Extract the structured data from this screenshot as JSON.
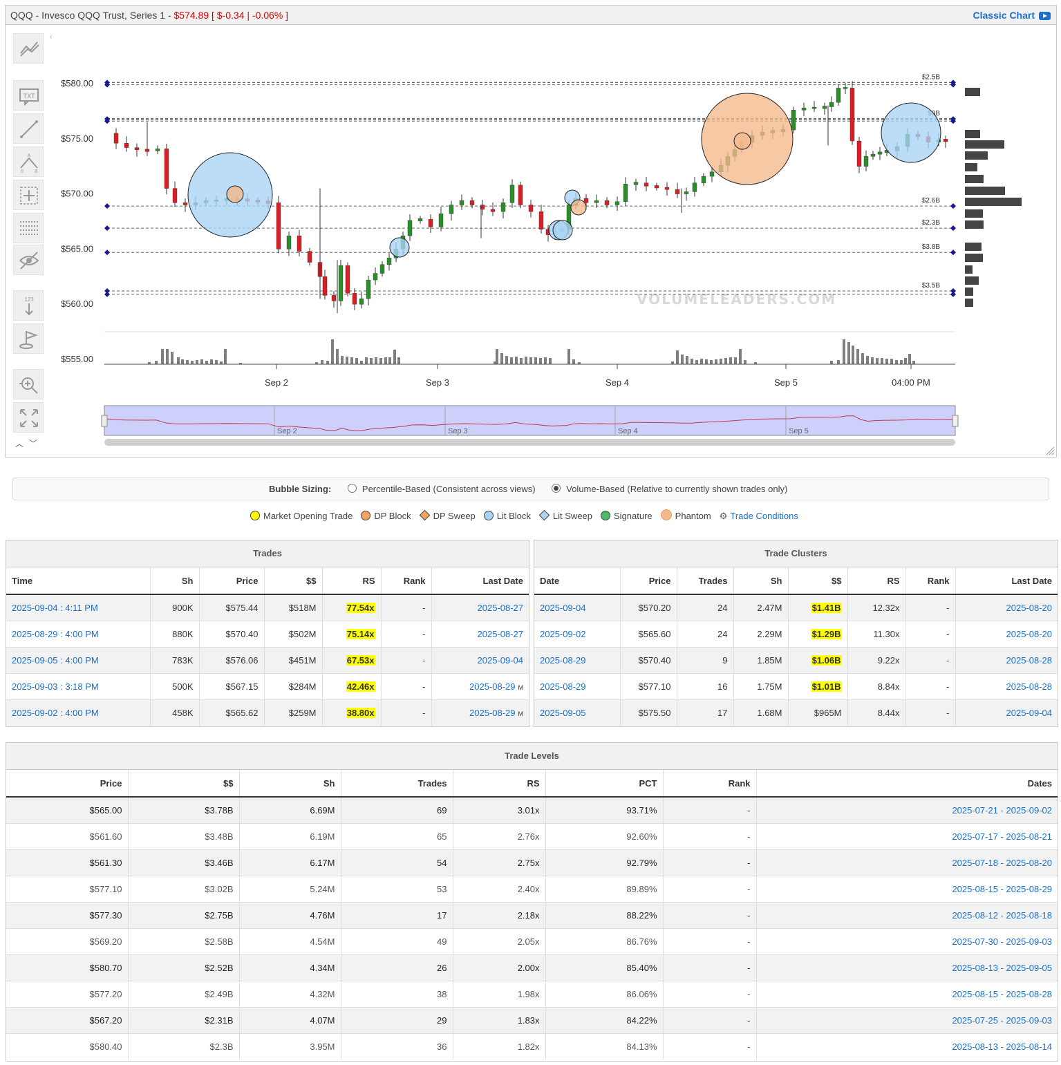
{
  "header": {
    "title_prefix": "QQQ - Invesco QQQ Trust, Series 1 - ",
    "price": "$574.89",
    "change": "[ $-0.34 | -0.06% ]",
    "classic_chart_label": "Classic Chart"
  },
  "chart": {
    "price_labels": [
      "$580.00",
      "$575.00",
      "$570.00",
      "$565.00",
      "$560.00",
      "$555.00"
    ],
    "date_labels": [
      "Sep 2",
      "Sep 3",
      "Sep 4",
      "Sep 5",
      "04:00 PM"
    ],
    "navigator_labels": [
      "Sep 2",
      "Sep 3",
      "Sep 4",
      "Sep 5"
    ],
    "level_tags": [
      "$2.5B",
      "$3B",
      "$2.6B",
      "$2.3B",
      "$3.8B",
      "$3.5B"
    ],
    "watermark": "VOLUMELEADERS.COM",
    "toolbar_icons": [
      "indicator-icon",
      "text-annotation-icon",
      "trendline-icon",
      "fibonacci-icon",
      "crosshair-icon",
      "horizontal-lines-icon",
      "hide-icon",
      "measure-icon",
      "flag-icon",
      "zoom-icon",
      "fullscreen-icon"
    ],
    "colors": {
      "up": "#2a8f2a",
      "down": "#d81f26",
      "lit_block": "#a9d4f5",
      "dp_block": "#f4b98a",
      "volume": "#7f7f7f"
    }
  },
  "bubble_sizing": {
    "label": "Bubble Sizing:",
    "options": [
      {
        "label": "Percentile-Based (Consistent across views)",
        "selected": false
      },
      {
        "label": "Volume-Based (Relative to currently shown trades only)",
        "selected": true
      }
    ]
  },
  "legend": [
    {
      "label": "Market Opening Trade",
      "shape": "circle",
      "color": "#ffff00"
    },
    {
      "label": "DP Block",
      "shape": "circle",
      "color": "#f4a460"
    },
    {
      "label": "DP Sweep",
      "shape": "diamond",
      "color": "#f4a460"
    },
    {
      "label": "Lit Block",
      "shape": "circle",
      "color": "#a9d4f5"
    },
    {
      "label": "Lit Sweep",
      "shape": "diamond",
      "color": "#a9d4f5"
    },
    {
      "label": "Signature",
      "shape": "circle",
      "color": "#4cbb6c"
    },
    {
      "label": "Phantom",
      "shape": "phantom",
      "color": "#f4b98a"
    },
    {
      "label": "Trade Conditions",
      "shape": "gear",
      "color": "#1a6fc9"
    }
  ],
  "trades": {
    "caption": "Trades",
    "columns": [
      "Time",
      "Sh",
      "Price",
      "$$",
      "RS",
      "Rank",
      "Last Date"
    ],
    "rows": [
      {
        "time": "2025-09-04 : 4:11 PM",
        "sh": "900K",
        "price": "$575.44",
        "dollars": "$518M",
        "rs": "77.54x",
        "rank": "-",
        "last_date": "2025-08-27",
        "mark": ""
      },
      {
        "time": "2025-08-29 : 4:00 PM",
        "sh": "880K",
        "price": "$570.40",
        "dollars": "$502M",
        "rs": "75.14x",
        "rank": "-",
        "last_date": "2025-08-27",
        "mark": ""
      },
      {
        "time": "2025-09-05 : 4:00 PM",
        "sh": "783K",
        "price": "$576.06",
        "dollars": "$451M",
        "rs": "67.53x",
        "rank": "-",
        "last_date": "2025-09-04",
        "mark": ""
      },
      {
        "time": "2025-09-03 : 3:18 PM",
        "sh": "500K",
        "price": "$567.15",
        "dollars": "$284M",
        "rs": "42.46x",
        "rank": "-",
        "last_date": "2025-08-29",
        "mark": "M"
      },
      {
        "time": "2025-09-02 : 4:00 PM",
        "sh": "458K",
        "price": "$565.62",
        "dollars": "$259M",
        "rs": "38.80x",
        "rank": "-",
        "last_date": "2025-08-29",
        "mark": "M"
      }
    ]
  },
  "clusters": {
    "caption": "Trade Clusters",
    "columns": [
      "Date",
      "Price",
      "Trades",
      "Sh",
      "$$",
      "RS",
      "Rank",
      "Last Date"
    ],
    "rows": [
      {
        "date": "2025-09-04",
        "price": "$570.20",
        "trades": "24",
        "sh": "2.47M",
        "dollars": "$1.41B",
        "hl": true,
        "rs": "12.32x",
        "rank": "-",
        "last_date": "2025-08-20"
      },
      {
        "date": "2025-09-02",
        "price": "$565.60",
        "trades": "24",
        "sh": "2.29M",
        "dollars": "$1.29B",
        "hl": true,
        "rs": "11.30x",
        "rank": "-",
        "last_date": "2025-08-20"
      },
      {
        "date": "2025-08-29",
        "price": "$570.40",
        "trades": "9",
        "sh": "1.85M",
        "dollars": "$1.06B",
        "hl": true,
        "rs": "9.22x",
        "rank": "-",
        "last_date": "2025-08-28"
      },
      {
        "date": "2025-08-29",
        "price": "$577.10",
        "trades": "16",
        "sh": "1.75M",
        "dollars": "$1.01B",
        "hl": true,
        "rs": "8.84x",
        "rank": "-",
        "last_date": "2025-08-28"
      },
      {
        "date": "2025-09-05",
        "price": "$575.50",
        "trades": "17",
        "sh": "1.68M",
        "dollars": "$965M",
        "hl": false,
        "rs": "8.44x",
        "rank": "-",
        "last_date": "2025-09-04"
      }
    ]
  },
  "levels": {
    "caption": "Trade Levels",
    "columns": [
      "Price",
      "$$",
      "Sh",
      "Trades",
      "RS",
      "PCT",
      "Rank",
      "Dates"
    ],
    "rows": [
      {
        "price": "$565.00",
        "dollars": "$3.78B",
        "sh": "6.69M",
        "trades": "69",
        "rs": "3.01x",
        "pct": "93.71%",
        "rank": "-",
        "dates": "2025-07-21 - 2025-09-02",
        "dark": true
      },
      {
        "price": "$561.60",
        "dollars": "$3.48B",
        "sh": "6.19M",
        "trades": "65",
        "rs": "2.76x",
        "pct": "92.60%",
        "rank": "-",
        "dates": "2025-07-17 - 2025-08-21",
        "dark": false
      },
      {
        "price": "$561.30",
        "dollars": "$3.46B",
        "sh": "6.17M",
        "trades": "54",
        "rs": "2.75x",
        "pct": "92.79%",
        "rank": "-",
        "dates": "2025-07-18 - 2025-08-20",
        "dark": true
      },
      {
        "price": "$577.10",
        "dollars": "$3.02B",
        "sh": "5.24M",
        "trades": "53",
        "rs": "2.40x",
        "pct": "89.89%",
        "rank": "-",
        "dates": "2025-08-15 - 2025-08-29",
        "dark": false
      },
      {
        "price": "$577.30",
        "dollars": "$2.75B",
        "sh": "4.76M",
        "trades": "17",
        "rs": "2.18x",
        "pct": "88.22%",
        "rank": "-",
        "dates": "2025-08-12 - 2025-08-18",
        "dark": true
      },
      {
        "price": "$569.20",
        "dollars": "$2.58B",
        "sh": "4.54M",
        "trades": "49",
        "rs": "2.05x",
        "pct": "86.76%",
        "rank": "-",
        "dates": "2025-07-30 - 2025-09-03",
        "dark": false
      },
      {
        "price": "$580.70",
        "dollars": "$2.52B",
        "sh": "4.34M",
        "trades": "26",
        "rs": "2.00x",
        "pct": "85.40%",
        "rank": "-",
        "dates": "2025-08-13 - 2025-09-05",
        "dark": true
      },
      {
        "price": "$577.20",
        "dollars": "$2.49B",
        "sh": "4.32M",
        "trades": "38",
        "rs": "1.98x",
        "pct": "86.06%",
        "rank": "-",
        "dates": "2025-08-15 - 2025-08-28",
        "dark": false
      },
      {
        "price": "$567.20",
        "dollars": "$2.31B",
        "sh": "4.07M",
        "trades": "29",
        "rs": "1.83x",
        "pct": "84.22%",
        "rank": "-",
        "dates": "2025-07-25 - 2025-09-03",
        "dark": true
      },
      {
        "price": "$580.40",
        "dollars": "$2.3B",
        "sh": "3.95M",
        "trades": "36",
        "rs": "1.82x",
        "pct": "84.13%",
        "rank": "-",
        "dates": "2025-08-13 - 2025-08-14",
        "dark": false
      }
    ]
  }
}
